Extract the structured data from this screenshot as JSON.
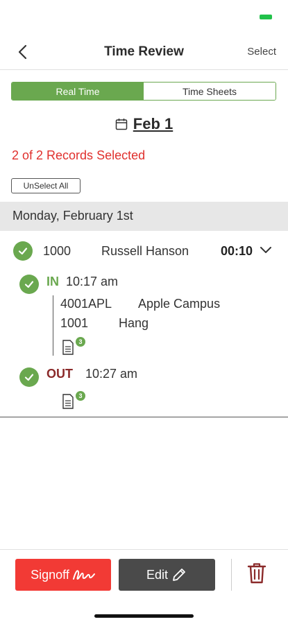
{
  "nav": {
    "title": "Time Review",
    "select_label": "Select"
  },
  "tabs": [
    {
      "label": "Real Time",
      "active": true
    },
    {
      "label": "Time Sheets",
      "active": false
    }
  ],
  "date": {
    "label": "Feb 1"
  },
  "selection": {
    "status": "2 of 2 Records Selected",
    "unselect_label": "UnSelect All"
  },
  "day": {
    "header": "Monday, February 1st"
  },
  "record": {
    "id": "1000",
    "name": "Russell Hanson",
    "duration": "00:10",
    "punch_in": {
      "label": "IN",
      "time": "10:17 am",
      "job_code": "4001APL",
      "job_name": "Apple Campus",
      "task_code": "1001",
      "task_name": "Hang",
      "notes_count": "3"
    },
    "punch_out": {
      "label": "OUT",
      "time": "10:27 am",
      "notes_count": "3"
    }
  },
  "actions": {
    "signoff_label": "Signoff",
    "edit_label": "Edit"
  },
  "colors": {
    "accent_green": "#6aa84f",
    "alert_red": "#e0302d",
    "signoff_red": "#f23a35",
    "out_label": "#8b2a2a"
  }
}
